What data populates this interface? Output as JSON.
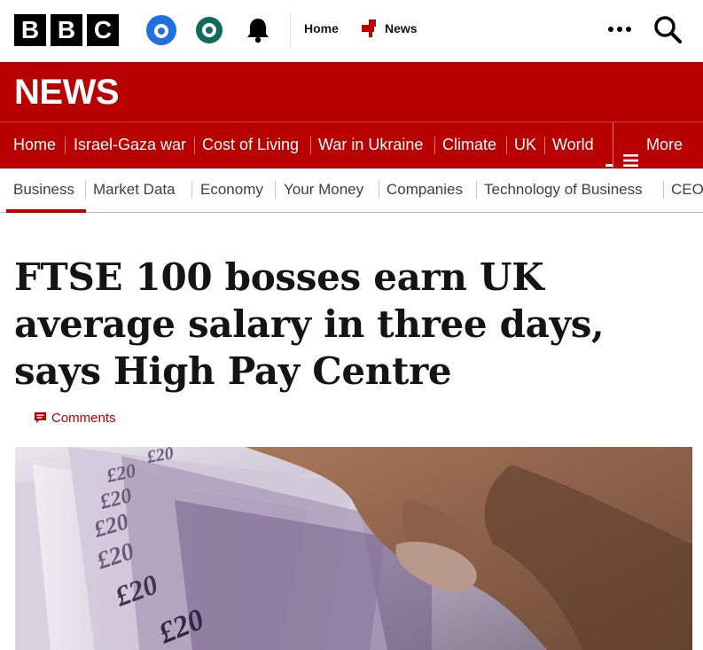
{
  "masthead": {
    "logo_letters": [
      "B",
      "B",
      "C"
    ],
    "icons": [
      "account-icon",
      "iplayer-icon",
      "bell-icon"
    ],
    "links": {
      "home": "Home",
      "news": "News"
    },
    "more_icon": "more-dots-icon",
    "search_icon": "search-icon"
  },
  "section": {
    "title": "NEWS"
  },
  "primary_nav": {
    "items": [
      "Home",
      "Israel-Gaza war",
      "Cost of Living",
      "War in Ukraine",
      "Climate",
      "UK",
      "World"
    ],
    "more_label": "More"
  },
  "secondary_nav": {
    "items": [
      "Business",
      "Market Data",
      "Economy",
      "Your Money",
      "Companies",
      "Technology of Business",
      "CEO"
    ],
    "active": "Business"
  },
  "article": {
    "headline": "FTSE 100 bosses earn UK average salary in three days, says High Pay Centre",
    "comments_label": "Comments"
  },
  "colors": {
    "brand_red": "#b80000",
    "text": "#141414",
    "account_blue": "#1f6fe5",
    "iplayer_green": "#0e6b5c"
  }
}
